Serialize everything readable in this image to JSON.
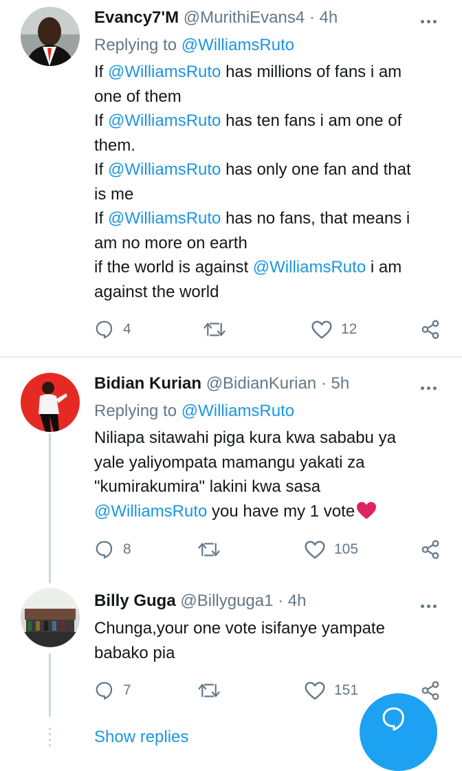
{
  "tweets": [
    {
      "name": "Evancy7'M",
      "handle": "@MurithiEvans4",
      "time": "· 4h",
      "replying_prefix": "Replying to ",
      "replying_to": "@WilliamsRuto",
      "lines": [
        {
          "pre": "If ",
          "mention": "@WilliamsRuto",
          "post": " has millions of fans i am"
        },
        {
          "pre": "one of them",
          "mention": "",
          "post": ""
        },
        {
          "pre": "If ",
          "mention": "@WilliamsRuto",
          "post": "  has ten fans i am one of"
        },
        {
          "pre": "them.",
          "mention": "",
          "post": ""
        },
        {
          "pre": "If ",
          "mention": "@WilliamsRuto",
          "post": "  has only one fan and that"
        },
        {
          "pre": "is me",
          "mention": "",
          "post": ""
        },
        {
          "pre": "If ",
          "mention": "@WilliamsRuto",
          "post": "  has no fans, that means i"
        },
        {
          "pre": "am no more on earth",
          "mention": "",
          "post": ""
        },
        {
          "pre": "if the world is against ",
          "mention": "@WilliamsRuto",
          "post": "  i am"
        },
        {
          "pre": "against the world",
          "mention": "",
          "post": ""
        }
      ],
      "replies": "4",
      "retweets": "",
      "likes": "12"
    },
    {
      "name": "Bidian Kurian",
      "handle": "@BidianKurian",
      "time": "· 5h",
      "replying_prefix": "Replying to ",
      "replying_to": "@WilliamsRuto",
      "lines": [
        {
          "pre": "Niliapa sitawahi piga kura kwa sababu ya",
          "mention": "",
          "post": ""
        },
        {
          "pre": "yale yaliyompata mamangu yakati za",
          "mention": "",
          "post": ""
        },
        {
          "pre": "\"kumirakumira\" lakini kwa sasa",
          "mention": "",
          "post": ""
        },
        {
          "pre": "",
          "mention": "@WilliamsRuto",
          "post": " you have my 1 vote"
        }
      ],
      "emoji": "heart",
      "replies": "8",
      "retweets": "",
      "likes": "105"
    },
    {
      "name": "Billy Guga",
      "handle": "@Billyguga1",
      "time": "· 4h",
      "lines": [
        {
          "pre": "Chunga,your one vote isifanye yampate",
          "mention": "",
          "post": ""
        },
        {
          "pre": "babako pia",
          "mention": "",
          "post": ""
        }
      ],
      "replies": "7",
      "retweets": "",
      "likes": "151"
    }
  ],
  "show_replies": "Show replies",
  "colors": {
    "accent": "#1da1f2",
    "mention": "#1b95e0",
    "muted": "#657786",
    "heart": "#e0245e"
  },
  "icons": [
    "reply-icon",
    "retweet-icon",
    "like-icon",
    "share-icon",
    "more-icon",
    "compose-icon"
  ]
}
